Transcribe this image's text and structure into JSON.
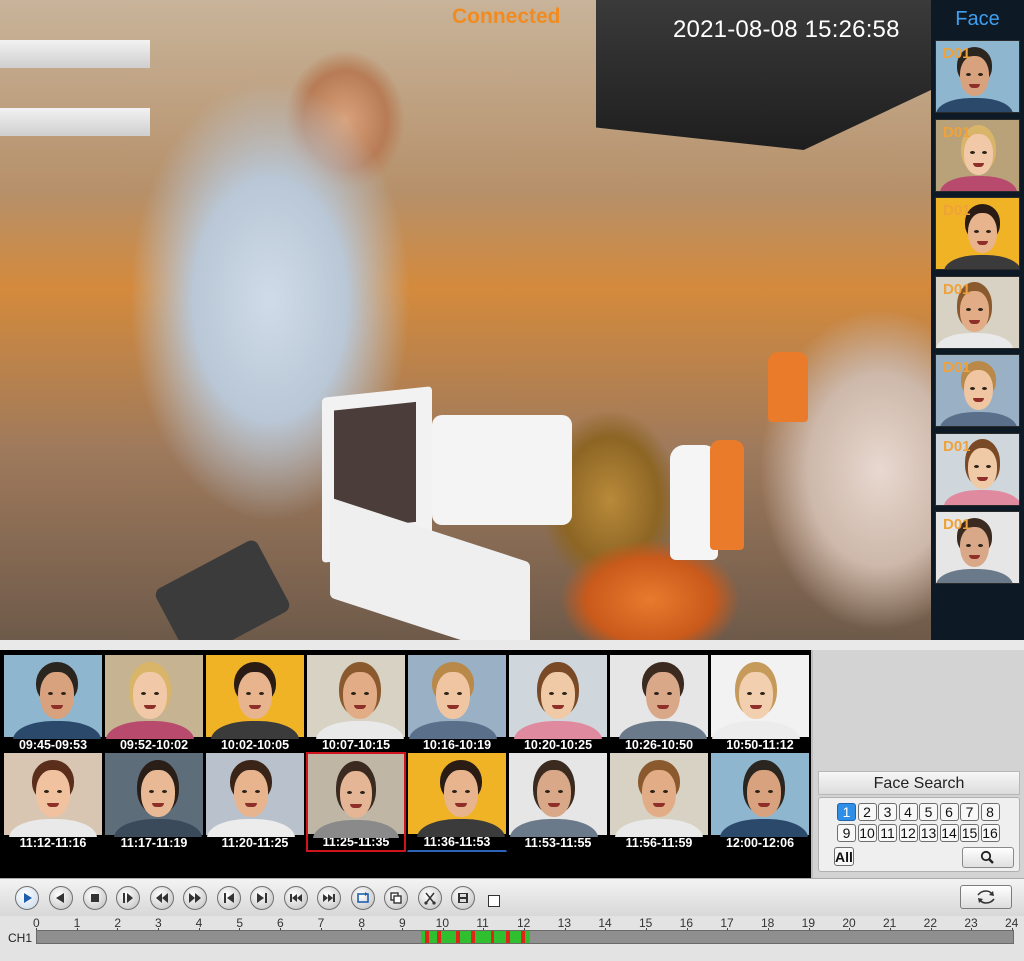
{
  "live": {
    "status": "Connected",
    "datetime": "2021-08-08 15:26:58"
  },
  "face_panel": {
    "title": "Face",
    "channel_label": "D01",
    "entries": [
      {
        "label": "D01",
        "skin": "#d9a27e",
        "hair": "#2b2520",
        "shirt": "#2b4a6b",
        "bg": "#8fb6cf"
      },
      {
        "label": "D01",
        "skin": "#f1c9a8",
        "hair": "#d9b56a",
        "shirt": "#b84a6e",
        "bg": "#b9a27a"
      },
      {
        "label": "D01",
        "skin": "#e7b48e",
        "hair": "#2a1c14",
        "shirt": "#3b3b3b",
        "bg": "#f0b326"
      },
      {
        "label": "D01",
        "skin": "#e2ad86",
        "hair": "#8a5a2e",
        "shirt": "#e9e9e9",
        "bg": "#d7d2c4"
      },
      {
        "label": "D01",
        "skin": "#f0c6a2",
        "hair": "#b9894a",
        "shirt": "#5a6f8a",
        "bg": "#9ab0c4"
      },
      {
        "label": "D01",
        "skin": "#f0c9a6",
        "hair": "#7a4a26",
        "shirt": "#e08aa0",
        "bg": "#cfd7dc"
      },
      {
        "label": "D01",
        "skin": "#d9a888",
        "hair": "#3a2a20",
        "shirt": "#6a7a8a",
        "bg": "#e6e6e6"
      }
    ]
  },
  "thumbnails": [
    {
      "time": "09:45-09:53",
      "skin": "#d9a27e",
      "hair": "#2b2520",
      "shirt": "#2b4a6b",
      "bg": "#8fb6cf"
    },
    {
      "time": "09:52-10:02",
      "skin": "#f1c9a8",
      "hair": "#d9b56a",
      "shirt": "#b84a6e",
      "bg": "#c6b392"
    },
    {
      "time": "10:02-10:05",
      "skin": "#e7b48e",
      "hair": "#2a1c14",
      "shirt": "#3b3b3b",
      "bg": "#f0b326"
    },
    {
      "time": "10:07-10:15",
      "skin": "#e2ad86",
      "hair": "#8a5a2e",
      "shirt": "#e9e9e9",
      "bg": "#d7d2c4"
    },
    {
      "time": "10:16-10:19",
      "skin": "#f0c6a2",
      "hair": "#b9894a",
      "shirt": "#5a6f8a",
      "bg": "#9ab0c4"
    },
    {
      "time": "10:20-10:25",
      "skin": "#f0c9a6",
      "hair": "#7a4a26",
      "shirt": "#e08aa0",
      "bg": "#cfd7dc"
    },
    {
      "time": "10:26-10:50",
      "skin": "#d9a888",
      "hair": "#3a2a20",
      "shirt": "#6a7a8a",
      "bg": "#e6e6e6"
    },
    {
      "time": "10:50-11:12",
      "skin": "#f2cfae",
      "hair": "#c59a5a",
      "shirt": "#ececec",
      "bg": "#f2f2f2"
    },
    {
      "time": "11:12-11:16",
      "skin": "#f0c2a0",
      "hair": "#5a2e1a",
      "shirt": "#e9e9e9",
      "bg": "#d8c6b2"
    },
    {
      "time": "11:17-11:19",
      "skin": "#e8b994",
      "hair": "#2a1e18",
      "shirt": "#3a4a5a",
      "bg": "#5e6d7a"
    },
    {
      "time": "11:20-11:25",
      "skin": "#e8b48e",
      "hair": "#3a2418",
      "shirt": "#ececec",
      "bg": "#b9c2cc"
    },
    {
      "time": "11:25-11:35",
      "skin": "#e4b696",
      "hair": "#3a2a20",
      "shirt": "#8a8a8a",
      "bg": "#bfb6a6"
    },
    {
      "time": "11:36-11:53",
      "skin": "#e7b48e",
      "hair": "#2a1c14",
      "shirt": "#3b3b3b",
      "bg": "#f0b326"
    },
    {
      "time": "11:53-11:55",
      "skin": "#d9a888",
      "hair": "#3a2a20",
      "shirt": "#6a7a8a",
      "bg": "#e6e6e6"
    },
    {
      "time": "11:56-11:59",
      "skin": "#e2ad86",
      "hair": "#8a5a2e",
      "shirt": "#e9e9e9",
      "bg": "#d7d2c4"
    },
    {
      "time": "12:00-12:06",
      "skin": "#d9a27e",
      "hair": "#2b2520",
      "shirt": "#2b4a6b",
      "bg": "#8fb6cf"
    }
  ],
  "face_search": {
    "title": "Face Search",
    "numbers": [
      "1",
      "2",
      "3",
      "4",
      "5",
      "6",
      "7",
      "8",
      "9",
      "10",
      "11",
      "12",
      "13",
      "14",
      "15",
      "16"
    ],
    "selected": "1",
    "all_label": "All",
    "search_icon": "magnifier-icon"
  },
  "controls": {
    "buttons": [
      {
        "name": "play-button",
        "icon": "play-icon"
      },
      {
        "name": "reverse-play-button",
        "icon": "reverse-play-icon"
      },
      {
        "name": "stop-button",
        "icon": "stop-icon"
      },
      {
        "name": "step-forward-button",
        "icon": "step-forward-icon"
      },
      {
        "name": "rewind-button",
        "icon": "rewind-icon"
      },
      {
        "name": "fast-forward-button",
        "icon": "fast-forward-icon"
      },
      {
        "name": "previous-button",
        "icon": "skip-back-icon"
      },
      {
        "name": "next-button",
        "icon": "skip-forward-icon"
      },
      {
        "name": "slow-backward-button",
        "icon": "double-skip-back-icon"
      },
      {
        "name": "slow-forward-button",
        "icon": "double-skip-forward-icon"
      },
      {
        "name": "loop-button",
        "icon": "loop-icon"
      },
      {
        "name": "copy-button",
        "icon": "copy-icon"
      },
      {
        "name": "clip-button",
        "icon": "scissors-icon"
      },
      {
        "name": "save-button",
        "icon": "disk-icon"
      }
    ],
    "sync_icon": "sync-icon"
  },
  "timeline": {
    "channel": "CH1",
    "hours": [
      "0",
      "1",
      "2",
      "3",
      "4",
      "5",
      "6",
      "7",
      "8",
      "9",
      "10",
      "11",
      "12",
      "13",
      "14",
      "15",
      "16",
      "17",
      "18",
      "19",
      "20",
      "21",
      "22",
      "23",
      "24"
    ],
    "record_start_hour": 9.45,
    "record_end_hour": 12.1,
    "colors": {
      "normal": "#2fbf2f",
      "event": "#e0241c",
      "track": "#8f8f8f"
    }
  }
}
